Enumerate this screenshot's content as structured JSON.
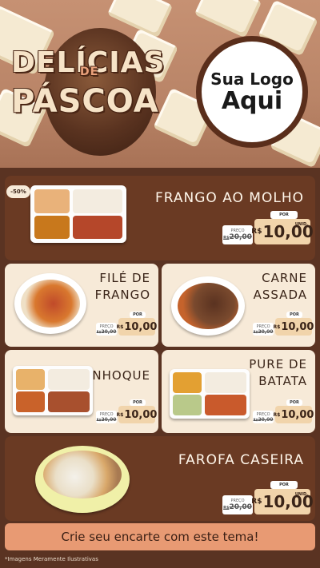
{
  "header": {
    "title_line1": "DELÍCIAS",
    "title_connector": "DE",
    "title_line2": "PÁSCOA",
    "logo_line1": "Sua Logo",
    "logo_line2": "Aqui"
  },
  "discount_badge": "-50%",
  "price_labels": {
    "old_label": "PREÇO",
    "new_label": "POR",
    "currency": "R$",
    "unit": "UNID."
  },
  "products": [
    {
      "name": "FRANGO AO MOLHO",
      "old_price": "20,00",
      "price": "10,00"
    },
    {
      "name": "FILÉ DE FRANGO",
      "old_price": "20,00",
      "price": "10,00"
    },
    {
      "name": "CARNE ASSADA",
      "old_price": "20,00",
      "price": "10,00"
    },
    {
      "name": "NHOQUE",
      "old_price": "20,00",
      "price": "10,00"
    },
    {
      "name": "PURE DE BATATA",
      "old_price": "20,00",
      "price": "10,00"
    },
    {
      "name": "FAROFA CASEIRA",
      "old_price": "20,00",
      "price": "10,00"
    }
  ],
  "cta": "Crie seu encarte com este tema!",
  "disclaimer": "*Imagens Meramente Ilustrativas",
  "colors": {
    "brown_dark": "#5a3322",
    "card_dark": "#6a3a23",
    "card_light": "#f7ead8",
    "cta": "#e89a73",
    "price_tag": "#f1d4ab"
  }
}
